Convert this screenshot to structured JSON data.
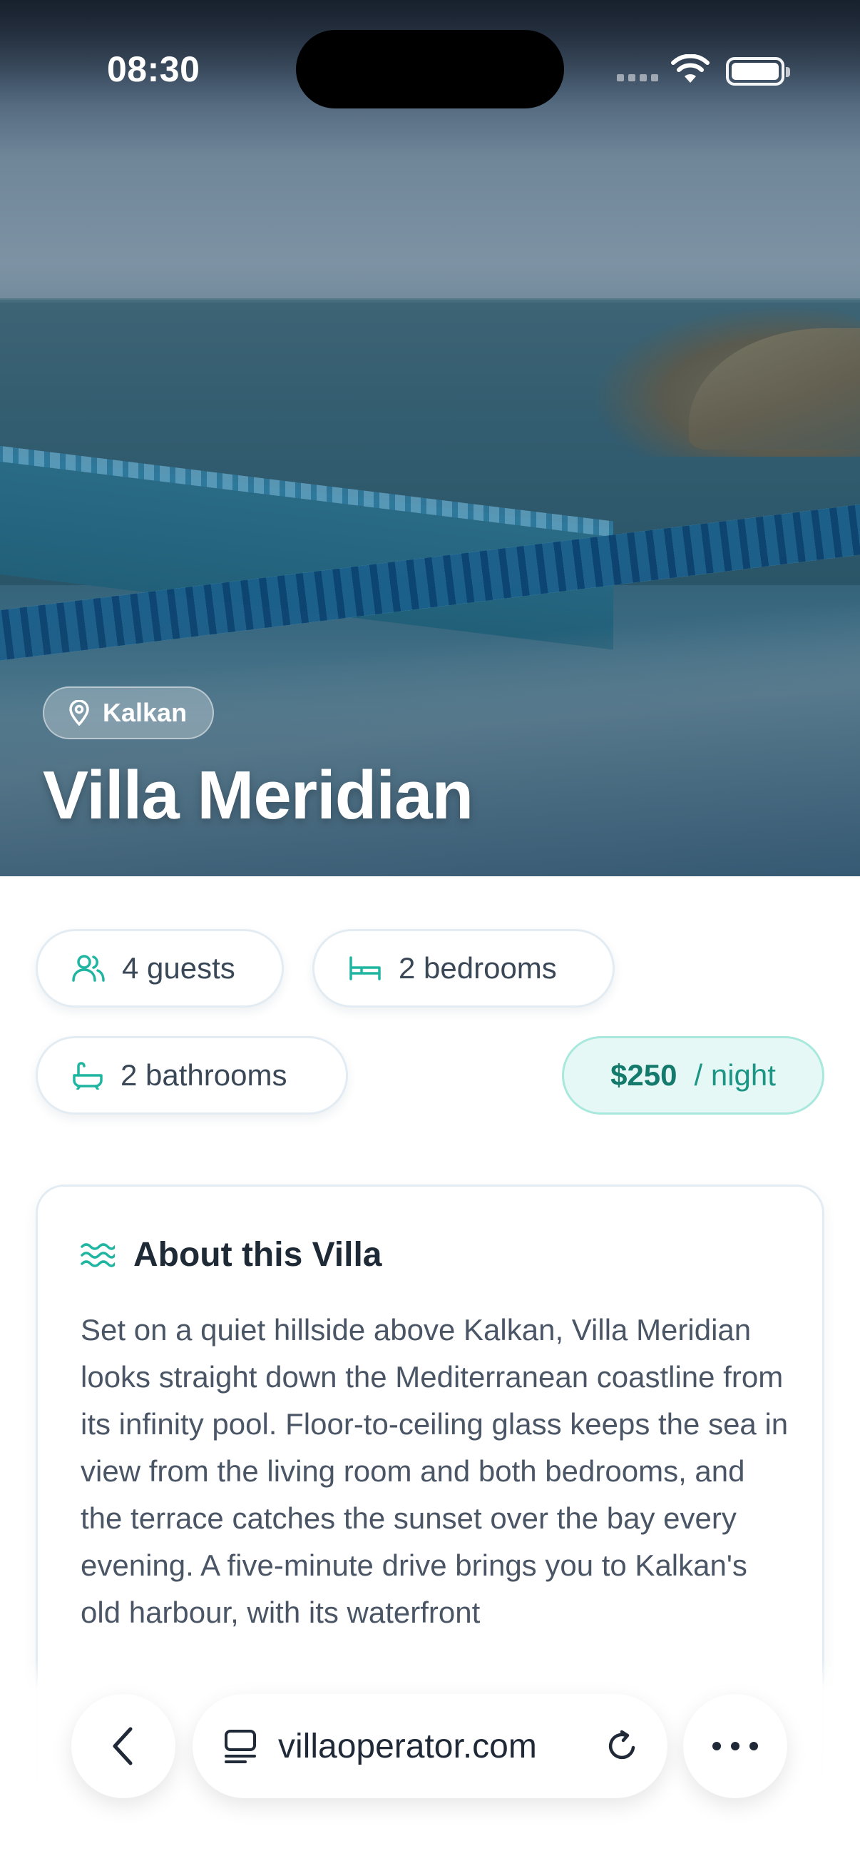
{
  "status_bar": {
    "time": "08:30"
  },
  "hero": {
    "location": "Kalkan",
    "title": "Villa Meridian"
  },
  "features": {
    "guests": "4 guests",
    "bedrooms": "2 bedrooms",
    "bathrooms": "2 bathrooms"
  },
  "price": {
    "amount": "$250",
    "unit": "/ night"
  },
  "about": {
    "title": "About this Villa",
    "text": "Set on a quiet hillside above Kalkan, Villa Meridian looks straight down the Mediterranean coastline from its infinity pool. Floor-to-ceiling glass keeps the sea in view from the living room and both bedrooms, and the terrace catches the sunset over the bay every evening. A five-minute drive brings you to Kalkan's old harbour, with its waterfront"
  },
  "browser": {
    "url": "villaoperator.com"
  },
  "colors": {
    "accent": "#1fb5a0",
    "price_bg": "#e6f8f5",
    "price_text": "#147a6c"
  }
}
